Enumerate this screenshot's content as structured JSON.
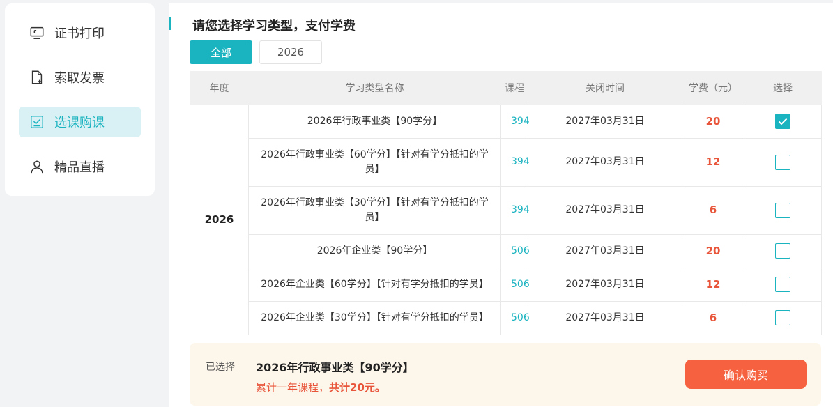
{
  "sidebar": {
    "items": [
      {
        "label": "证书打印",
        "icon": "certificate-print-icon"
      },
      {
        "label": "索取发票",
        "icon": "invoice-icon"
      },
      {
        "label": "选课购课",
        "icon": "course-select-icon",
        "active": true
      },
      {
        "label": "精品直播",
        "icon": "user-icon"
      }
    ]
  },
  "main": {
    "title": "请您选择学习类型，支付学费",
    "filters": [
      "全部",
      "2026"
    ],
    "table": {
      "headers": [
        "年度",
        "学习类型名称",
        "课程",
        "关闭时间",
        "学费（元）",
        "选择"
      ],
      "year": "2026",
      "rows": [
        {
          "name": "2026年行政事业类【90学分】",
          "course": "394",
          "close": "2027年03月31日",
          "fee": "20",
          "checked": true
        },
        {
          "name": "2026年行政事业类【60学分】【针对有学分抵扣的学员】",
          "course": "394",
          "close": "2027年03月31日",
          "fee": "12",
          "checked": false
        },
        {
          "name": "2026年行政事业类【30学分】【针对有学分抵扣的学员】",
          "course": "394",
          "close": "2027年03月31日",
          "fee": "6",
          "checked": false
        },
        {
          "name": "2026年企业类【90学分】",
          "course": "506",
          "close": "2027年03月31日",
          "fee": "20",
          "checked": false
        },
        {
          "name": "2026年企业类【60学分】【针对有学分抵扣的学员】",
          "course": "506",
          "close": "2027年03月31日",
          "fee": "12",
          "checked": false
        },
        {
          "name": "2026年企业类【30学分】【针对有学分抵扣的学员】",
          "course": "506",
          "close": "2027年03月31日",
          "fee": "6",
          "checked": false
        }
      ]
    },
    "summary": {
      "label": "已选择",
      "selected": "2026年行政事业类【90学分】",
      "desc_prefix": "累计一年课程，",
      "desc_total": "共计20元。",
      "confirm_label": "确认购买"
    }
  },
  "colors": {
    "accent": "#1ab3c0",
    "fee": "#e8553a",
    "button": "#f6623f",
    "summary_bg": "#fdf6ea"
  }
}
